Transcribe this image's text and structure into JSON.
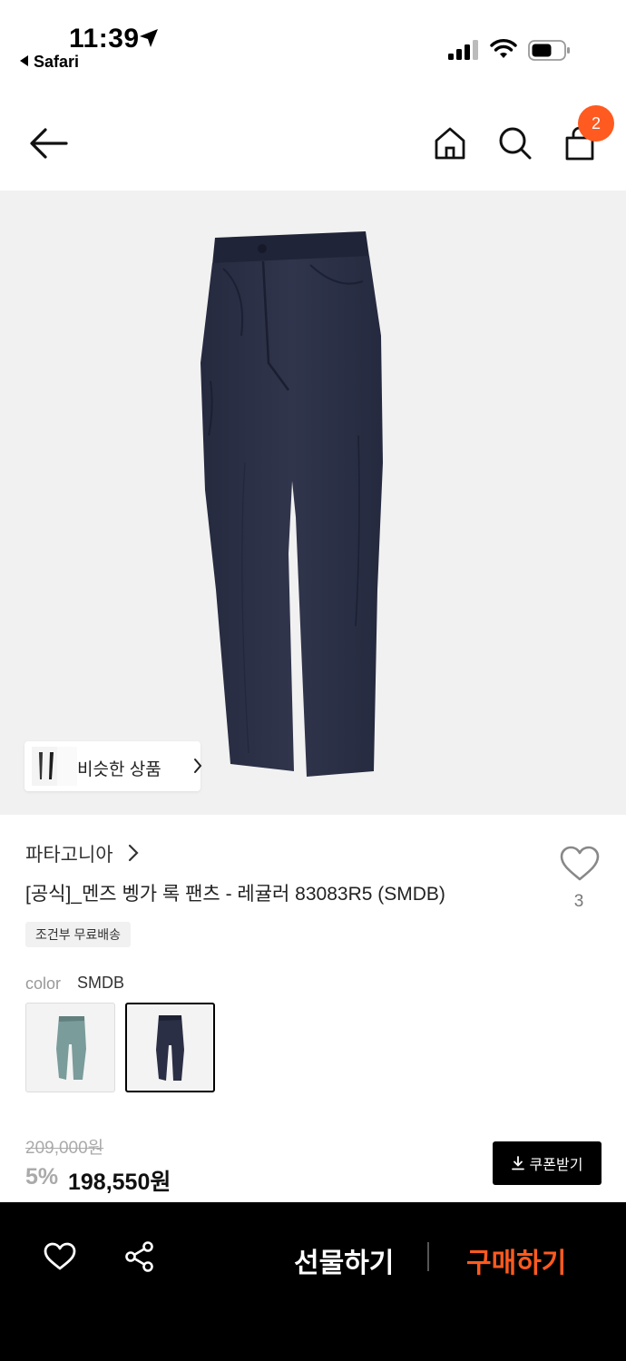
{
  "status_bar": {
    "time": "11:39",
    "back_app": "Safari"
  },
  "nav": {
    "cart_count": "2"
  },
  "hero": {
    "similar_label": "비슷한 상품"
  },
  "product": {
    "brand": "파타고니아",
    "title": "[공식]_멘즈 벵가 록 팬츠 - 레귤러 83083R5 (SMDB)",
    "wish_count": "3",
    "shipping_badge": "조건부 무료배송",
    "color_label": "color",
    "color_value": "SMDB",
    "swatches": [
      {
        "name": "sage",
        "color": "#7a9c9a",
        "selected": false
      },
      {
        "name": "navy",
        "color": "#2b2f45",
        "selected": true
      }
    ],
    "original_price": "209,000원",
    "discount": "5%",
    "price": "198,550원",
    "coupon_label": "쿠폰받기"
  },
  "bottom_bar": {
    "gift_label": "선물하기",
    "buy_label": "구매하기"
  },
  "colors": {
    "accent": "#ff5a1f",
    "product_navy": "#2b2f45"
  }
}
